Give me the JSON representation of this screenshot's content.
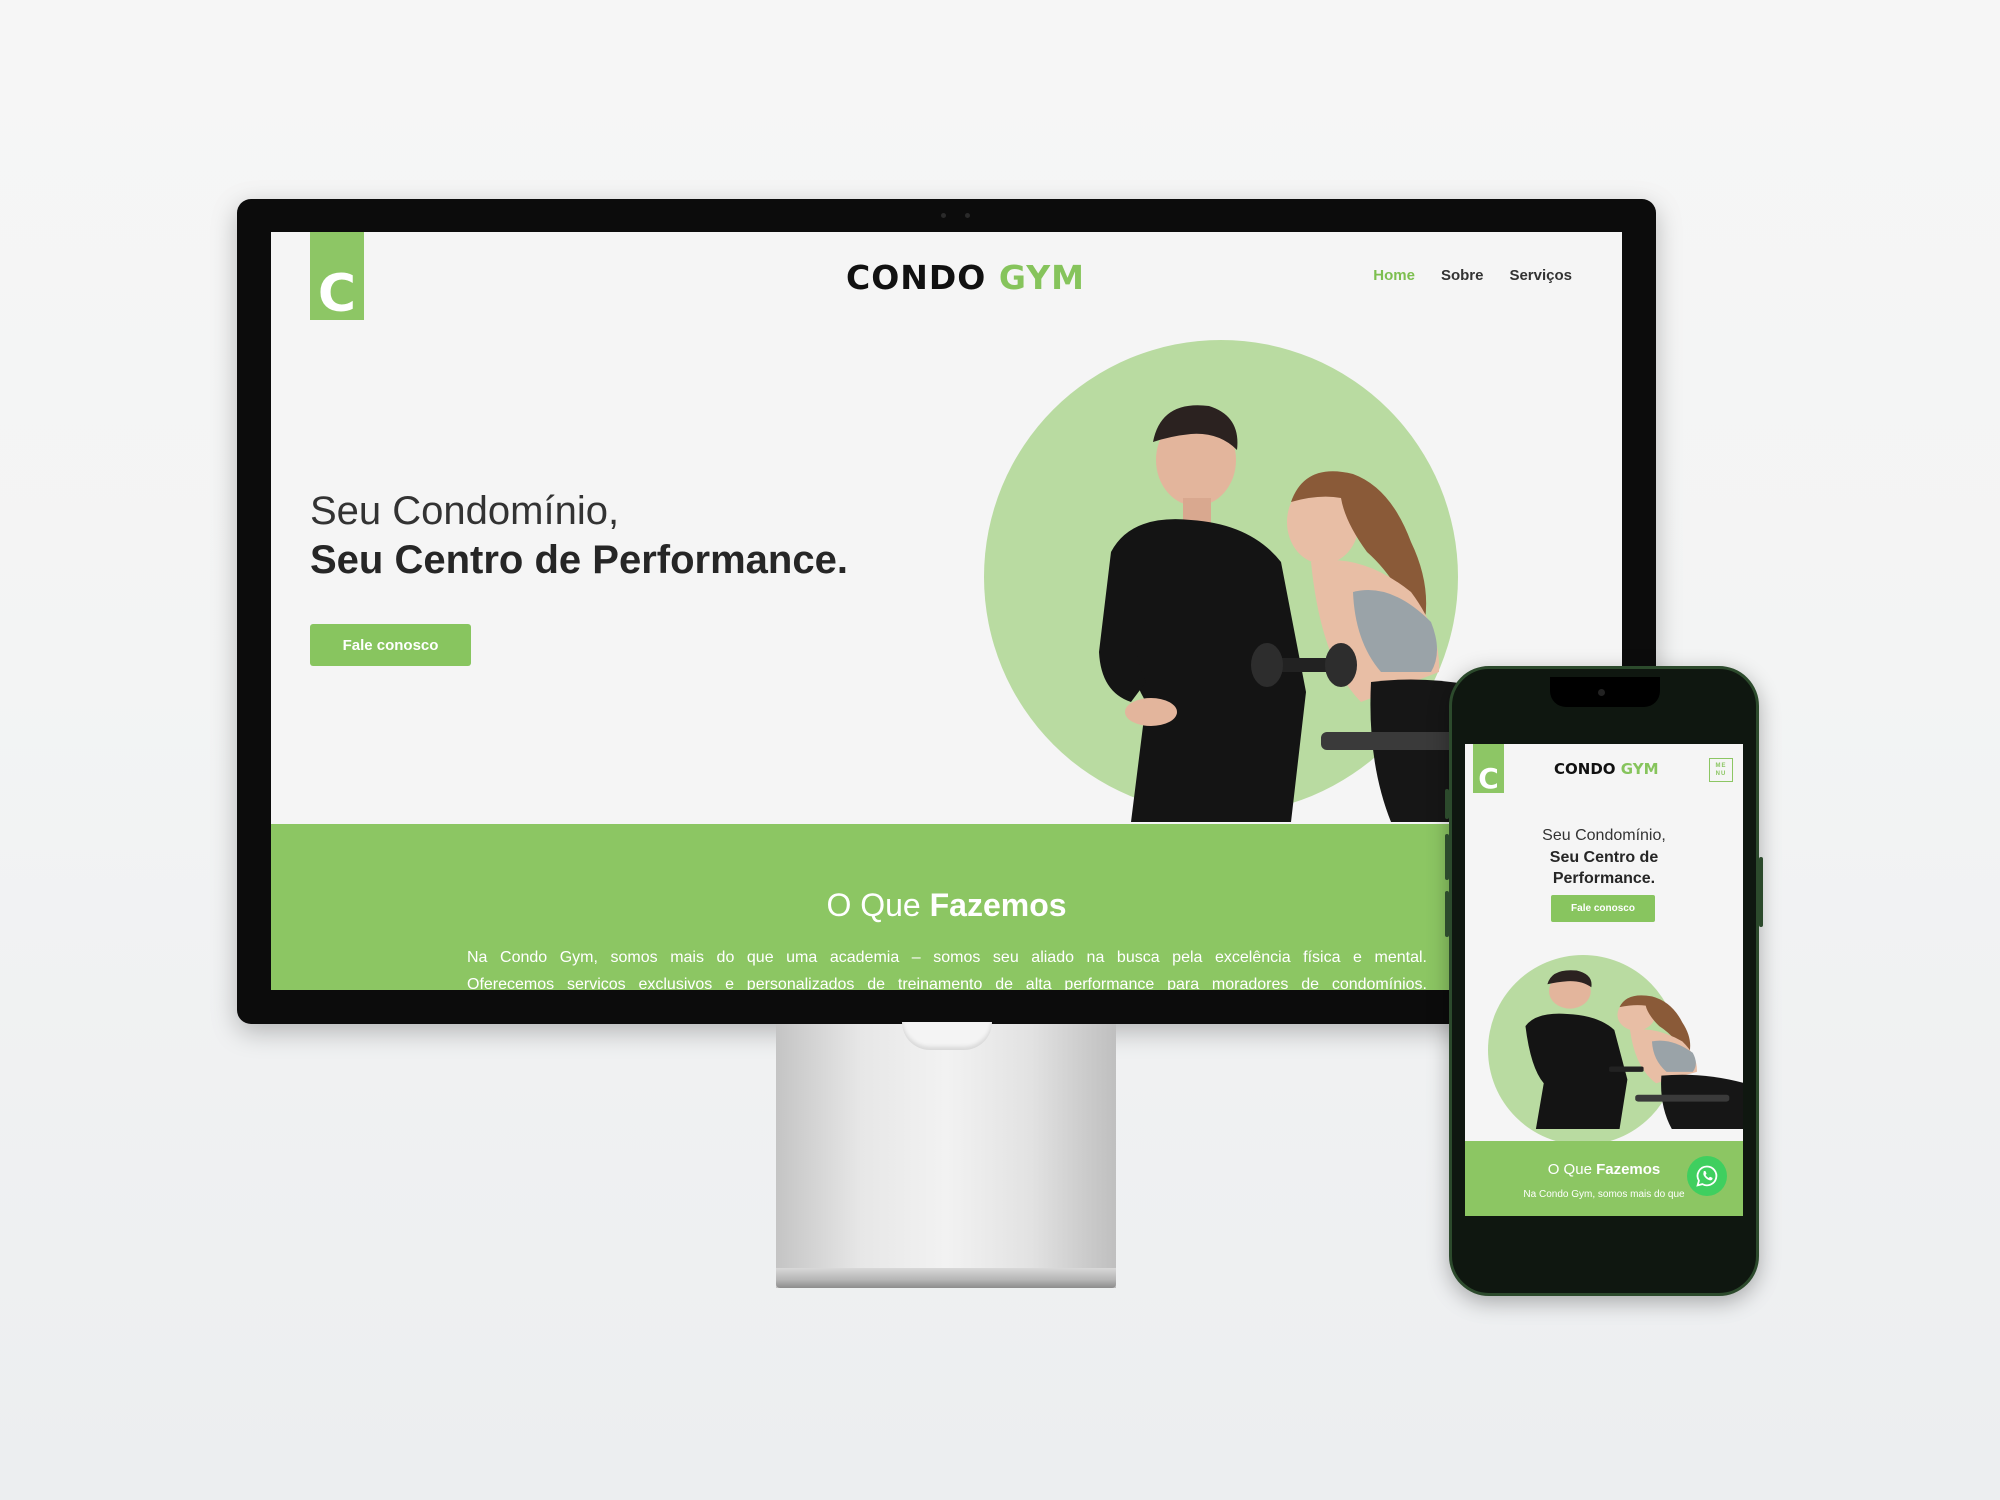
{
  "desktop": {
    "logo_letter": "C",
    "brand": {
      "main": "CONDO",
      "accent": "GYM"
    },
    "nav": [
      {
        "label": "Home",
        "active": true
      },
      {
        "label": "Sobre",
        "active": false
      },
      {
        "label": "Serviços",
        "active": false
      }
    ],
    "hero": {
      "line1": "Seu Condomínio,",
      "line2": "Seu Centro de Performance.",
      "cta": "Fale conosco"
    },
    "section": {
      "title_light": "O Que",
      "title_bold": "Fazemos",
      "text_line1": "Na Condo Gym, somos mais do que uma academia – somos seu aliado na busca pela excelência física e mental.",
      "text_line2": "Oferecemos serviços exclusivos e personalizados de treinamento de alta performance para moradores de condomínios."
    }
  },
  "mobile": {
    "logo_letter": "C",
    "brand": {
      "main": "CONDO",
      "accent": "GYM"
    },
    "menu": {
      "line1": "ME",
      "line2": "NU"
    },
    "hero": {
      "line1": "Seu Condomínio,",
      "line2": "Seu Centro de",
      "line3": "Performance.",
      "cta": "Fale conosco"
    },
    "section": {
      "title_light": "O Que",
      "title_bold": "Fazemos",
      "text": "Na Condo Gym, somos mais do que"
    }
  },
  "colors": {
    "accent": "#8cc663",
    "accent_light": "#b9dba1",
    "whatsapp": "#3fcf5f"
  }
}
